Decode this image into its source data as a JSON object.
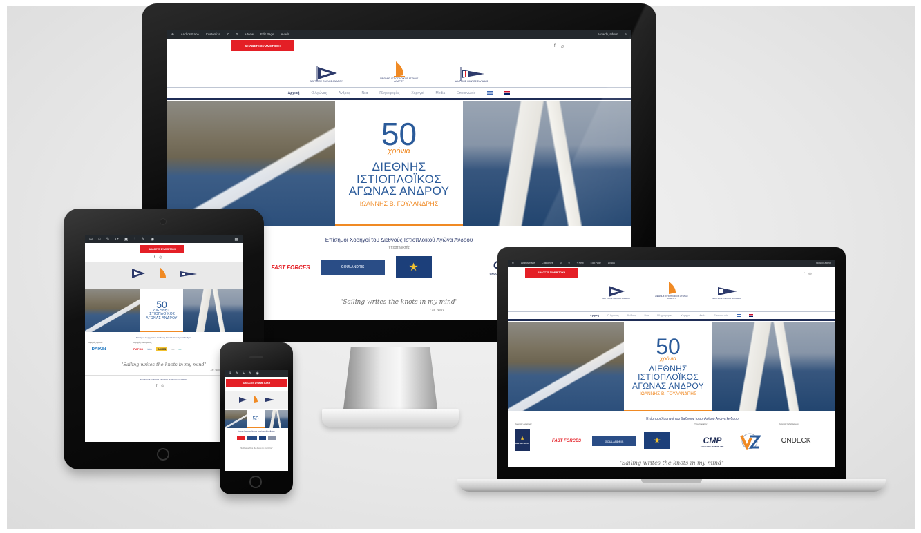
{
  "admin_bar": {
    "items": [
      "Andros Race",
      "Customize",
      "0",
      "0",
      "+ New",
      "Edit Page",
      "Avada"
    ],
    "greeting": "Howdy, admin"
  },
  "site": {
    "donate_button": "ΔΗΛΩΣΤΕ ΣΥΜΜΕΤΟΧΗ",
    "social": [
      "f",
      "◎"
    ],
    "logos": [
      {
        "caption": "ΝΑΥΤΙΚΟΣ ΟΜΙΛΟΣ ΑΝΔΡΟΥ",
        "color": "#2d3a6b"
      },
      {
        "caption": "ΔΙΕΘΝΗΣ ΙΣΤΙΟΠΛΟΪΚΟΣ ΑΓΩΝΑΣ ΑΝΔΡΟΥ",
        "color": "#f08a24"
      },
      {
        "caption": "ΝΑΥΤΙΚΟΣ ΟΜΙΛΟΣ ΕΛΛΑΔΟΣ",
        "color": "#2d3a6b"
      }
    ],
    "nav": [
      "Αρχική",
      "Ο Αγώνας",
      "Άνδρος",
      "Νέα",
      "Πληροφορίες",
      "Χορηγοί",
      "Media",
      "Επικοινωνία"
    ],
    "banner": {
      "years": "50",
      "years_word": "χρόνια",
      "line1": "ΔΙΕΘΝΗΣ",
      "line2": "ΙΣΤΙΟΠΛΟΪΚΟΣ",
      "line3": "ΑΓΩΝΑΣ ΑΝΔΡΟΥ",
      "subtitle": "ΙΩΑΝΝΗΣ Β. ΓΟΥΛΑΝΔΡΗΣ"
    },
    "sponsors_title": "Επίσημοι Χορηγοί του Διεθνούς Ιστιοπλοϊκού Αγώνα Άνδρου",
    "sponsors_subtitle": "Υποστηρικτής",
    "sponsors": [
      "FAST FORCES",
      "GOULANDRIS",
      "★",
      "CMP",
      "ONDECK"
    ],
    "cmp_sub": "CHUGOKU PAINTS LTD.",
    "quote": "\"Sailing writes the knots in my mind\"",
    "quote_author": "- M. Wally"
  },
  "tablet_site": {
    "sponsor_labels": [
      "Χορηγός Αγώνα",
      "Χορηγός Ανοίγματος"
    ],
    "sponsor_names": [
      "DAIKIN",
      "ΠΑΡΚΟ",
      "≈≈≈",
      "AXIOS",
      "—",
      "—"
    ],
    "footer": "ΝΑΥΤΙΚΟΣ ΟΜΙΛΟΣ ΑΝΔΡΟΥ ΠΑΡΑΛΙΑ ΝΕΟΡΙΟΥ"
  },
  "laptop_site": {
    "sponsor_labels": [
      "Χορηγός Αλυσίδας",
      "Υποστηρικτής",
      "Χορηγός Εξοπλισμού"
    ],
    "bluestar": "Blue Star Ferries"
  },
  "colors": {
    "accent_red": "#e41f26",
    "navy": "#1f2d56",
    "orange": "#f08a24",
    "blue": "#2b5b9a"
  }
}
